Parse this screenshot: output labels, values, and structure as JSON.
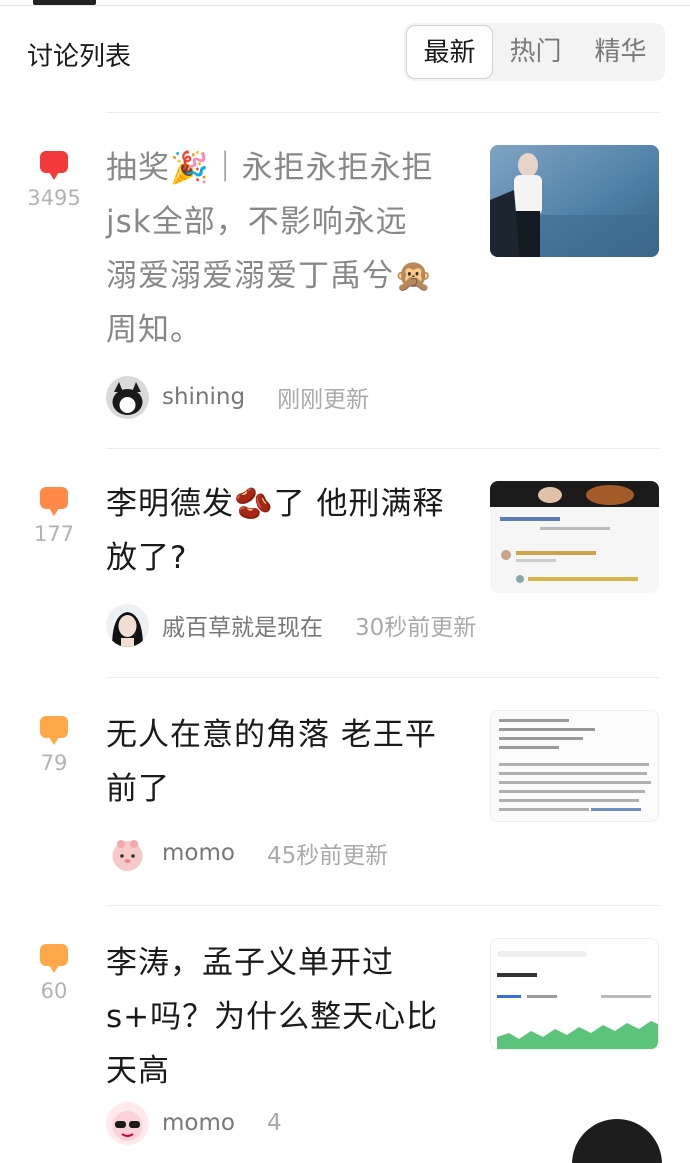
{
  "header": {
    "title": "讨论列表",
    "tabs": [
      {
        "label": "最新",
        "active": true
      },
      {
        "label": "热门",
        "active": false
      },
      {
        "label": "精华",
        "active": false
      }
    ]
  },
  "colors": {
    "hot": "#f23a3a",
    "warm": "#ff8a47",
    "mild": "#ffa84a"
  },
  "posts": [
    {
      "count": "3495",
      "heat": "hot",
      "title": "抽奖🎉｜永拒永拒永拒jsk全部，不影响永远溺爱溺爱溺爱丁禹兮🙊 周知。",
      "author": "shining",
      "time": "刚刚更新",
      "thumbnail": "photo-icon"
    },
    {
      "count": "177",
      "heat": "warm",
      "title": "李明德发🫘了 他刑满释放了?",
      "author": "戚百草就是现在",
      "time": "30秒前更新",
      "thumbnail": "screenshot-icon"
    },
    {
      "count": "79",
      "heat": "mild",
      "title": "无人在意的角落 老王平前了",
      "author": "momo",
      "time": "45秒前更新",
      "thumbnail": "text-card-icon"
    },
    {
      "count": "60",
      "heat": "mild",
      "title": "李涛，孟子义单开过s+吗？为什么整天心比天高",
      "author": "momo",
      "time": "4",
      "thumbnail": "chart-icon"
    }
  ]
}
